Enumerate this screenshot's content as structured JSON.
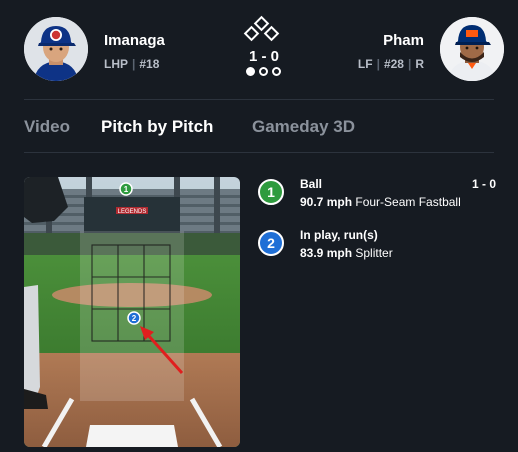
{
  "pitcher": {
    "name": "Imanaga",
    "position": "LHP",
    "number": "#18"
  },
  "batter": {
    "name": "Pham",
    "position": "LF",
    "number": "#28",
    "bats": "R"
  },
  "game_state": {
    "count": "1 - 0",
    "outs": 1,
    "bases_occupied": []
  },
  "tabs": [
    {
      "label": "Video",
      "active": false
    },
    {
      "label": "Pitch by Pitch",
      "active": true
    },
    {
      "label": "Gameday 3D",
      "active": false
    }
  ],
  "pitch_view": {
    "board_text": "LEGENDS",
    "pitches": [
      {
        "number": "1",
        "color": "#2e9b3e"
      },
      {
        "number": "2",
        "color": "#1f6fd6"
      }
    ]
  },
  "pitches": [
    {
      "number": "1",
      "result": "Ball",
      "count": "1 - 0",
      "speed": "90.7 mph",
      "type": "Four-Seam Fastball",
      "color": "#2e9b3e"
    },
    {
      "number": "2",
      "result": "In play, run(s)",
      "count": "",
      "speed": "83.9 mph",
      "type": "Splitter",
      "color": "#1f6fd6"
    }
  ],
  "colors": {
    "background": "#161b22",
    "divider": "#2c333d",
    "tab_inactive": "#8b929c",
    "annotation_arrow": "#e01e1e"
  }
}
